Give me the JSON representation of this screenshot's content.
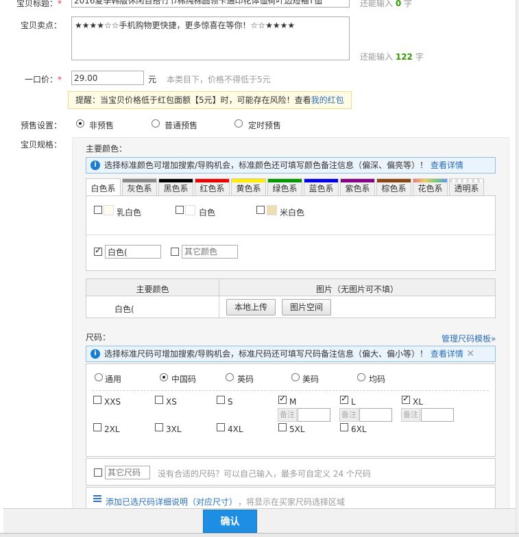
{
  "title_row": {
    "label": "宝贝标题：",
    "value": "2016夏季韩版休闲百搭竹节棉纯棉圆领卡通印花体恤荷叶边短袖T恤",
    "remain_prefix": "还能输入",
    "remain_num": "0",
    "remain_suffix": "字"
  },
  "selling_point": {
    "label": "宝贝卖点：",
    "value": "★★★★☆☆手机购物更快捷，更多惊喜在等你！☆☆★★★★",
    "remain_prefix": "还能输入",
    "remain_num": "122",
    "remain_suffix": "字"
  },
  "price": {
    "label": "一口价：",
    "value": "29.00",
    "unit": "元",
    "hint": "本类目下，价格不得低于5元"
  },
  "warning": {
    "text": "提醒：当宝贝价格低于红包面额【5元】时，可能存在风险！查看",
    "link": "我的红包"
  },
  "presale": {
    "label": "预售设置：",
    "options": [
      "非预售",
      "普通预售",
      "定时预售"
    ],
    "selected": 0
  },
  "spec": {
    "label": "宝贝规格：",
    "color_title": "主要颜色：",
    "color_info": "选择标准颜色可增加搜索/导购机会，标准颜色还可填写颜色备注信息（偏深、偏亮等）！",
    "color_info_link": "查看详情",
    "tabs": [
      {
        "label": "白色系",
        "bar": "#ffffff"
      },
      {
        "label": "灰色系",
        "bar": "#888888"
      },
      {
        "label": "黑色系",
        "bar": "#000000"
      },
      {
        "label": "红色系",
        "bar": "#ee0000"
      },
      {
        "label": "黄色系",
        "bar": "#ffee00"
      },
      {
        "label": "绿色系",
        "bar": "#009900"
      },
      {
        "label": "蓝色系",
        "bar": "#0000ee"
      },
      {
        "label": "紫色系",
        "bar": "#880088"
      },
      {
        "label": "棕色系",
        "bar": "#8b4513"
      },
      {
        "label": "花色系",
        "bar": "#dd9966"
      },
      {
        "label": "透明系",
        "bar": "#dddddd"
      }
    ],
    "colors": [
      {
        "name": "乳白色",
        "swatch": "#fffbf0"
      },
      {
        "name": "白色",
        "swatch": "#ffffff"
      },
      {
        "name": "米白色",
        "swatch": "#eedeb0"
      }
    ],
    "custom_color_value": "白色(",
    "other_color_placeholder": "其它颜色",
    "table_headers": [
      "主要颜色",
      "图片（无图片可不填）"
    ],
    "table_row_color": "白色(",
    "upload_local": "本地上传",
    "upload_space": "图片空间",
    "size_title": "尺码：",
    "size_manage_link": "管理尺码模板»",
    "size_info": "选择标准尺码可增加搜索/导购机会，标准尺码还可填写尺码备注信息（偏大、偏小等）！",
    "size_info_link": "查看详情",
    "size_types": [
      "通用",
      "中国码",
      "英码",
      "美码",
      "均码"
    ],
    "size_type_selected": 1,
    "sizes_row1": [
      {
        "label": "XXS",
        "checked": false
      },
      {
        "label": "XS",
        "checked": false
      },
      {
        "label": "S",
        "checked": false
      },
      {
        "label": "M",
        "checked": true
      },
      {
        "label": "L",
        "checked": true
      },
      {
        "label": "XL",
        "checked": true
      }
    ],
    "sizes_row2": [
      {
        "label": "2XL",
        "checked": false
      },
      {
        "label": "3XL",
        "checked": false
      },
      {
        "label": "4XL",
        "checked": false
      },
      {
        "label": "5XL",
        "checked": false
      },
      {
        "label": "6XL",
        "checked": false
      }
    ],
    "note_label": "备注",
    "other_size_placeholder": "其它尺码",
    "other_size_hint": "没有合适的尺码？可以自己输入，最多可自定义 24 个尺码",
    "size_detail_link": "添加已选尺码详细说明（对应尺寸）",
    "size_detail_suffix": "，将显示在买家尺码选择区域"
  },
  "confirm_label": "确认"
}
